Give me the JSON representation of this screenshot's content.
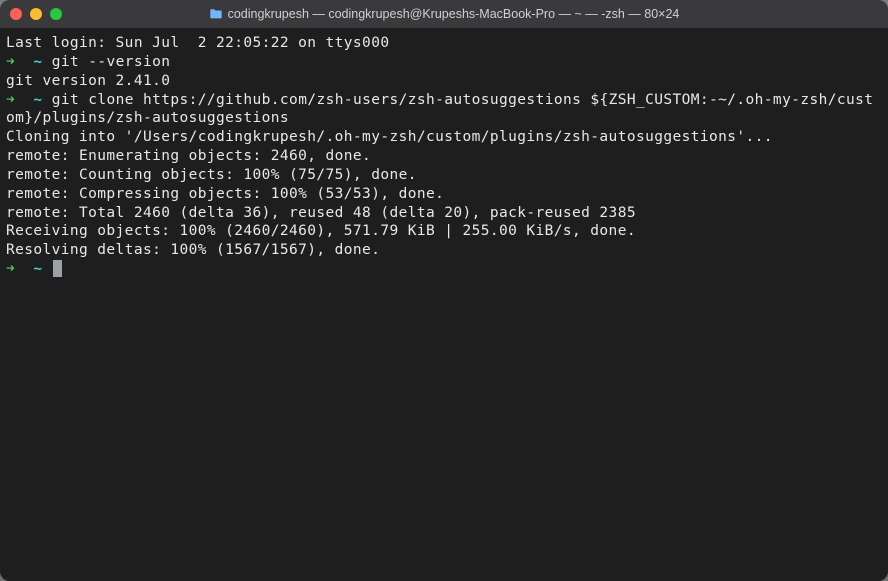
{
  "window": {
    "title": "codingkrupesh — codingkrupesh@Krupeshs-MacBook-Pro — ~ — -zsh — 80×24"
  },
  "lines": {
    "last_login": "Last login: Sun Jul  2 22:05:22 on ttys000",
    "prompt_arrow": "➜",
    "prompt_tilde": "~",
    "cmd1": "git --version",
    "out1": "git version 2.41.0",
    "cmd2": "git clone https://github.com/zsh-users/zsh-autosuggestions ${ZSH_CUSTOM:-~/.oh-my-zsh/custom}/plugins/zsh-autosuggestions",
    "out2": "Cloning into '/Users/codingkrupesh/.oh-my-zsh/custom/plugins/zsh-autosuggestions'...",
    "out3": "remote: Enumerating objects: 2460, done.",
    "out4": "remote: Counting objects: 100% (75/75), done.",
    "out5": "remote: Compressing objects: 100% (53/53), done.",
    "out6": "remote: Total 2460 (delta 36), reused 48 (delta 20), pack-reused 2385",
    "out7": "Receiving objects: 100% (2460/2460), 571.79 KiB | 255.00 KiB/s, done.",
    "out8": "Resolving deltas: 100% (1567/1567), done."
  }
}
